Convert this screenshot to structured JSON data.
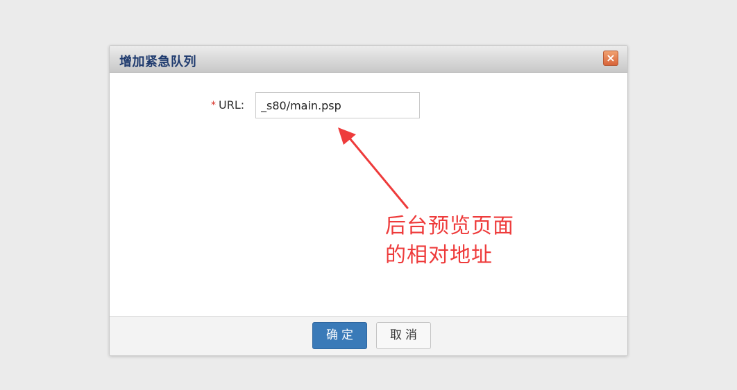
{
  "dialog": {
    "title": "增加紧急队列",
    "close_glyph": "×"
  },
  "form": {
    "required_mark": "*",
    "url_label": "URL:",
    "url_value": "_s80/main.psp"
  },
  "annotation": {
    "line1": "后台预览页面",
    "line2": "的相对地址",
    "color": "#ee3b3b"
  },
  "footer": {
    "ok_label": "确定",
    "cancel_label": "取消"
  },
  "colors": {
    "primary_button": "#3a7ab8",
    "title_text": "#1e3a6e",
    "close_button": "#d8643a"
  }
}
